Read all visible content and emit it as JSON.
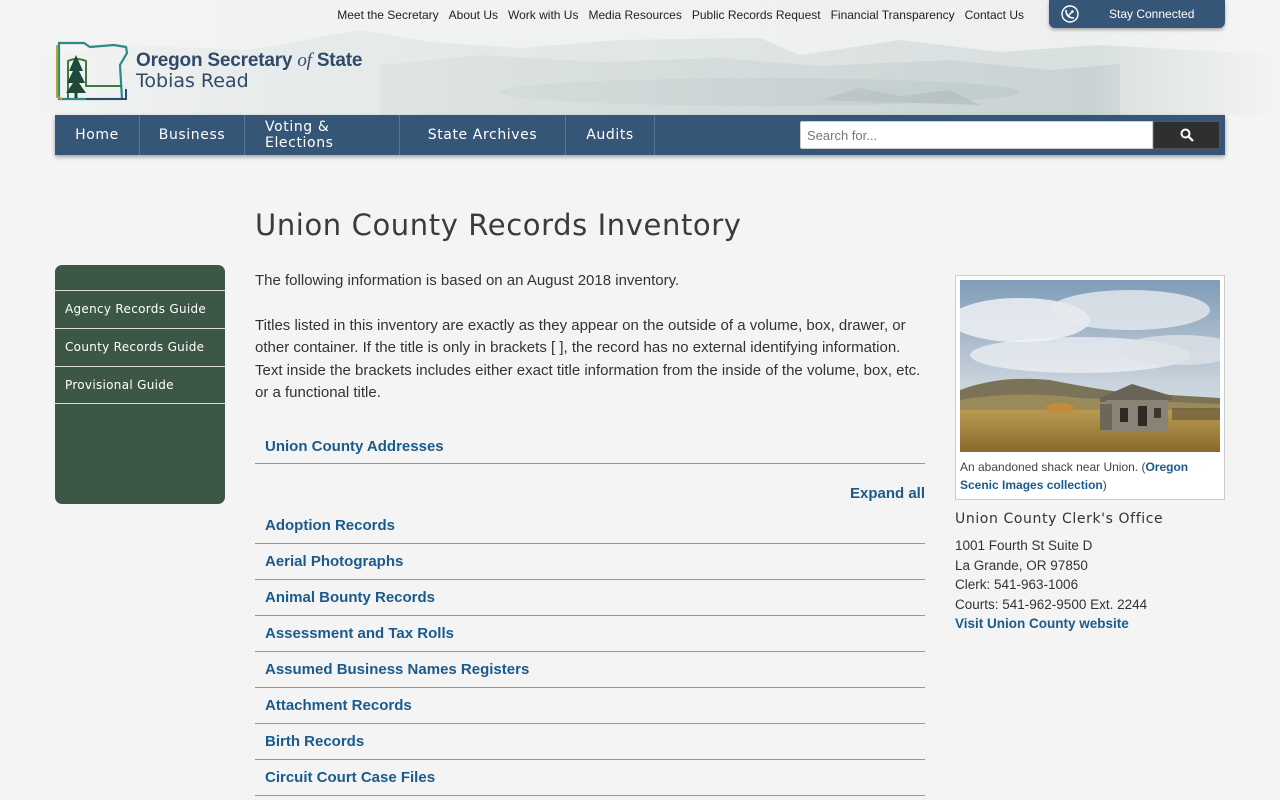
{
  "utility_nav": [
    "Meet the Secretary",
    "About Us",
    "Work with Us",
    "Media Resources",
    "Public Records Request",
    "Financial Transparency",
    "Contact Us"
  ],
  "stay_connected": {
    "label": "Stay Connected",
    "icon": "satellite-dish-icon"
  },
  "logo": {
    "line1_a": "Oregon Secretary ",
    "line1_of": "of",
    "line1_b": " State",
    "line2": "Tobias Read",
    "icon": "oregon-tree-logo-icon"
  },
  "main_nav": [
    "Home",
    "Business",
    "Voting & Elections",
    "State Archives",
    "Audits"
  ],
  "search": {
    "placeholder": "Search for...",
    "icon": "search-icon"
  },
  "page_title": "Union County Records Inventory",
  "sidebar": [
    "Agency Records Guide",
    "County Records Guide",
    "Provisional Guide"
  ],
  "intro": {
    "p1": "The following information is based on an August 2018 inventory.",
    "p2": "Titles listed in this inventory are exactly as they appear on the outside of a volume, box, drawer, or other container. If the title is only in brackets [ ], the record has no external identifying information. Text inside the brackets includes either exact title information from the inside of the volume, box, etc. or a functional title."
  },
  "addresses_link": "Union County Addresses",
  "expand_all": "Expand all",
  "records": [
    "Adoption Records",
    "Aerial Photographs",
    "Animal Bounty Records",
    "Assessment and Tax Rolls",
    "Assumed Business Names Registers",
    "Attachment Records",
    "Birth Records",
    "Circuit Court Case Files"
  ],
  "photo": {
    "caption_text": "An abandoned shack near Union. (",
    "caption_link": "Oregon Scenic Images collection",
    "caption_end": ")"
  },
  "clerk": {
    "heading": "Union County Clerk's Office",
    "address1": "1001 Fourth St Suite D",
    "address2": "La Grande, OR 97850",
    "clerk_phone": "Clerk: 541-963-1006",
    "courts_phone": "Courts: 541-962-9500 Ext. 2244",
    "website_link": "Visit Union County website"
  },
  "colors": {
    "nav_blue": "#365677",
    "sidebar_green": "#3d5746",
    "link_blue": "#1a5b8e"
  }
}
